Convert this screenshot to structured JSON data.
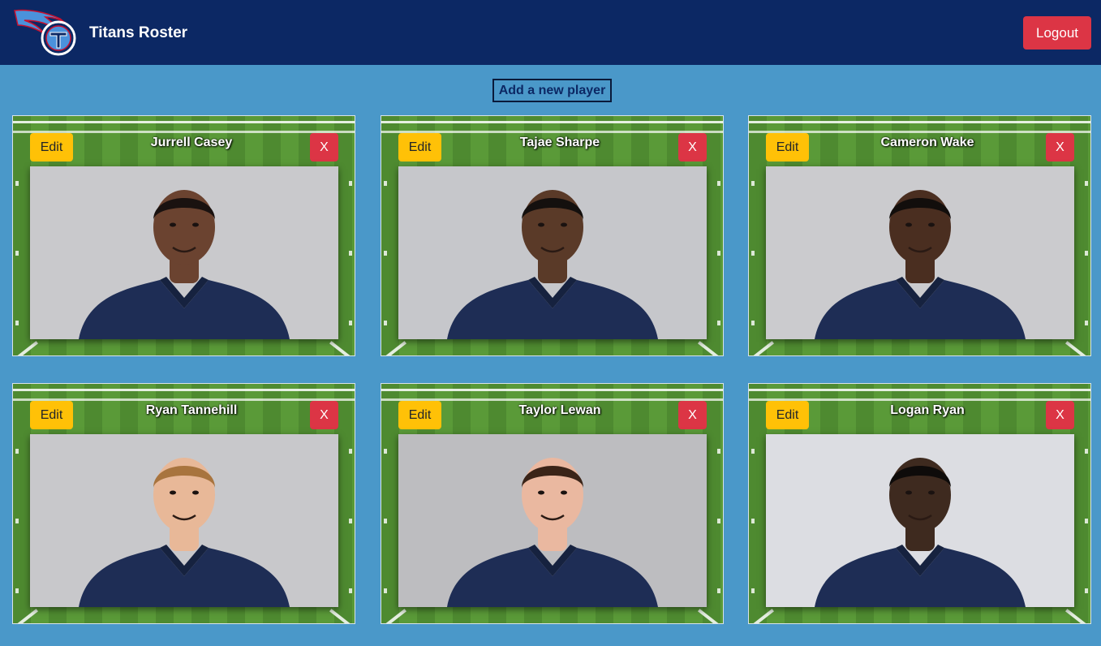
{
  "navbar": {
    "brand": "Titans Roster",
    "logout_label": "Logout"
  },
  "add_player_label": "Add a new player",
  "card_labels": {
    "edit": "Edit",
    "delete": "X"
  },
  "players": [
    {
      "name": "Jurrell Casey"
    },
    {
      "name": "Tajae Sharpe"
    },
    {
      "name": "Cameron Wake"
    },
    {
      "name": "Ryan Tannehill"
    },
    {
      "name": "Taylor Lewan"
    },
    {
      "name": "Logan Ryan"
    }
  ],
  "colors": {
    "navbar": "#0c2864",
    "page_background": "#4a98c9",
    "edit_button": "#ffc107",
    "delete_button": "#dc3545",
    "jersey": "#1e2d55"
  }
}
